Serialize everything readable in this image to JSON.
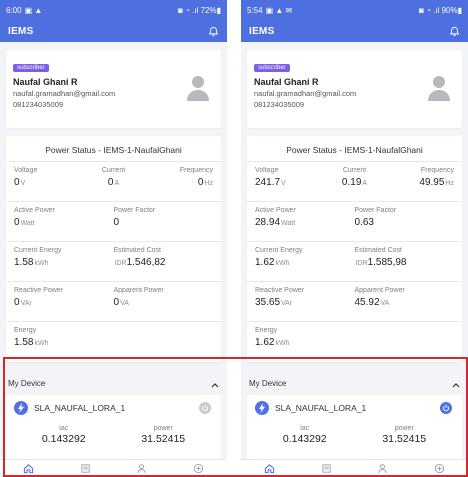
{
  "colors": {
    "primary": "#4d6fe0",
    "badge": "#7b5fe8",
    "highlight": "#d9262b"
  },
  "phones": [
    {
      "status": {
        "time": "6:00",
        "icons": "▣ ▲",
        "right": "◙ ◔ .ıl 72%▮"
      },
      "app_title": "IEMS",
      "profile": {
        "badge": "subscriber",
        "name": "Naufal Ghani R",
        "email": "naufal.gramadhan@gmail.com",
        "phone": "081234035009"
      },
      "power_title": "Power Status - IEMS-1-NaufalGhani",
      "metrics": {
        "voltage": {
          "label": "Voltage",
          "value": "0",
          "unit": "V"
        },
        "current": {
          "label": "Current",
          "value": "0",
          "unit": "A"
        },
        "frequency": {
          "label": "Frequency",
          "value": "0",
          "unit": "Hz"
        },
        "active_power": {
          "label": "Active Power",
          "value": "0",
          "unit": "Watt"
        },
        "power_factor": {
          "label": "Power Factor",
          "value": "0"
        },
        "current_energy": {
          "label": "Current Energy",
          "value": "1.58",
          "unit": "kWh"
        },
        "estimated_cost": {
          "label": "Estimated Cost",
          "prefix": "IDR",
          "value": "1.546,82"
        },
        "reactive_power": {
          "label": "Reactive Power",
          "value": "0",
          "unit": "VAr"
        },
        "apparent_power": {
          "label": "Apparent Power",
          "value": "0",
          "unit": "VA"
        },
        "energy": {
          "label": "Energy",
          "value": "1.58",
          "unit": "kWh"
        }
      },
      "device_section": {
        "title": "My Device",
        "device_name": "SLA_NAUFAL_LORA_1",
        "iac_label": "iac",
        "iac_value": "0.143292",
        "power_label": "power",
        "power_value": "31.52415"
      }
    },
    {
      "status": {
        "time": "5:54",
        "icons": "▣ ▲ ✉",
        "right": "◙ ◔ .ıl 90%▮"
      },
      "app_title": "IEMS",
      "profile": {
        "badge": "subscriber",
        "name": "Naufal Ghani R",
        "email": "naufal.gramadhan@gmail.com",
        "phone": "081234035009"
      },
      "power_title": "Power Status - IEMS-1-NaufalGhani",
      "metrics": {
        "voltage": {
          "label": "Voltage",
          "value": "241.7",
          "unit": "V"
        },
        "current": {
          "label": "Current",
          "value": "0.19",
          "unit": "A"
        },
        "frequency": {
          "label": "Frequency",
          "value": "49.95",
          "unit": "Hz"
        },
        "active_power": {
          "label": "Active Power",
          "value": "28.94",
          "unit": "Watt"
        },
        "power_factor": {
          "label": "Power Factor",
          "value": "0.63"
        },
        "current_energy": {
          "label": "Current Energy",
          "value": "1.62",
          "unit": "kWh"
        },
        "estimated_cost": {
          "label": "Estimated Cost",
          "prefix": "IDR",
          "value": "1.585,98"
        },
        "reactive_power": {
          "label": "Reactive Power",
          "value": "35.65",
          "unit": "VAr"
        },
        "apparent_power": {
          "label": "Apparent Power",
          "value": "45.92",
          "unit": "VA"
        },
        "energy": {
          "label": "Energy",
          "value": "1.62",
          "unit": "kWh"
        }
      },
      "device_section": {
        "title": "My Device",
        "device_name": "SLA_NAUFAL_LORA_1",
        "iac_label": "iac",
        "iac_value": "0.143292",
        "power_label": "power",
        "power_value": "31.52415"
      }
    }
  ]
}
